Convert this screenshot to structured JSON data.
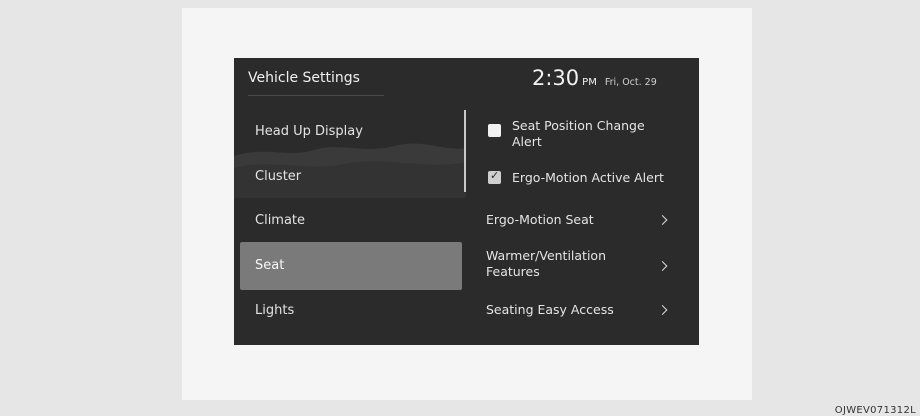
{
  "header": {
    "title": "Vehicle Settings",
    "time": "2:30",
    "ampm": "PM",
    "date": "Fri, Oct. 29"
  },
  "menu": {
    "items": [
      {
        "label": "Head Up Display"
      },
      {
        "label": "Cluster"
      },
      {
        "label": "Climate"
      },
      {
        "label": "Seat",
        "selected": true
      },
      {
        "label": "Lights"
      }
    ]
  },
  "options": {
    "seat_position_change_alert": {
      "label_line1": "Seat Position Change",
      "label_line2": "Alert",
      "checked": false
    },
    "ergo_motion_active_alert": {
      "label": "Ergo-Motion Active Alert",
      "checked": true
    }
  },
  "nav": {
    "ergo_motion_seat": "Ergo-Motion Seat",
    "warmer_line1": "Warmer/Ventilation",
    "warmer_line2": "Features",
    "seating_easy_access": "Seating Easy Access"
  },
  "figure_code": "OJWEV071312L"
}
